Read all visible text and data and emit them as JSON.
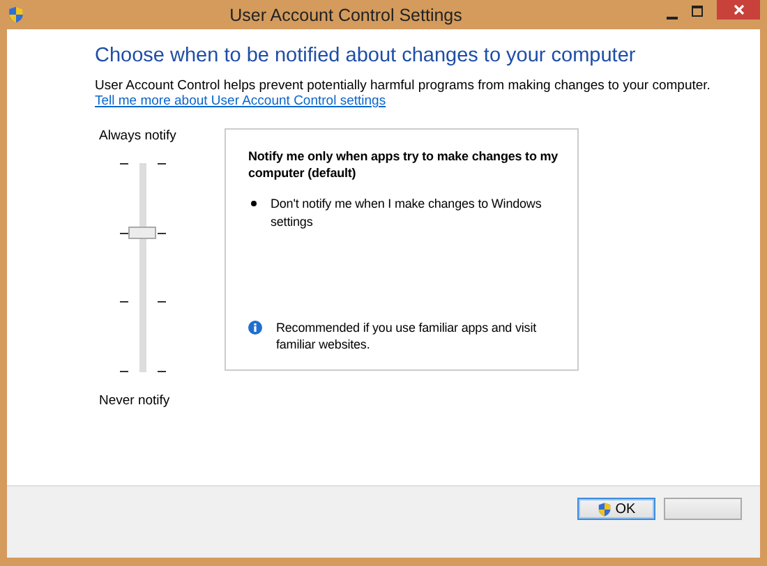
{
  "window": {
    "title": "User Account Control Settings"
  },
  "heading": "Choose when to be notified about changes to your computer",
  "description": "User Account Control helps prevent potentially harmful programs from making changes to your computer.",
  "link": "Tell me more about User Account Control settings",
  "slider": {
    "top_label": "Always notify",
    "bottom_label": "Never notify",
    "level": 0.667
  },
  "info_box": {
    "title": "Notify me only when apps try to make changes to my computer (default)",
    "bullets": [
      "Don't notify me when I make changes to Windows settings"
    ],
    "recommendation": "Recommended if you use familiar apps and visit familiar websites."
  },
  "buttons": [
    {
      "kind": "shield",
      "label": "OK",
      "default": true
    },
    {
      "kind": "blank",
      "default": false
    }
  ]
}
